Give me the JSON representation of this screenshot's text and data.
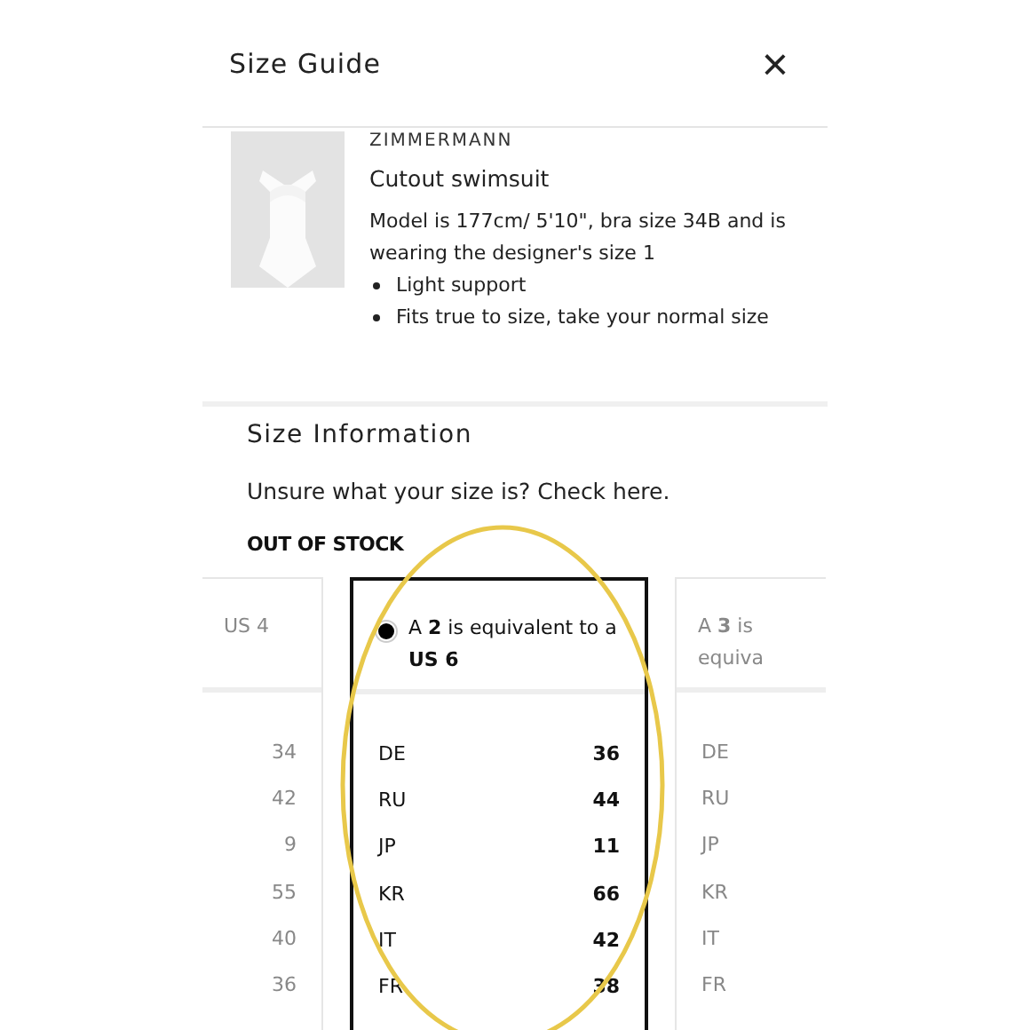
{
  "header": {
    "title": "Size Guide",
    "close": "×"
  },
  "product": {
    "brand": "ZIMMERMANN",
    "name": "Cutout swimsuit",
    "description": "Model is 177cm/ 5'10\", bra size 34B and is wearing the designer's size 1",
    "bullets": [
      "Light support",
      "Fits true to size, take your normal size"
    ]
  },
  "size_info": {
    "title": "Size Information",
    "help": "Unsure what your size is? Check here.",
    "stock": "OUT OF STOCK"
  },
  "cards": [
    {
      "kind": "values",
      "selected": false,
      "heading": "US 4",
      "rows": [
        {
          "value": "34"
        },
        {
          "value": "42"
        },
        {
          "value": "9"
        },
        {
          "value": "55"
        },
        {
          "value": "40"
        },
        {
          "value": "36"
        }
      ]
    },
    {
      "kind": "full",
      "selected": true,
      "heading": "A **2** is equivalent to a **US 6**",
      "rows": [
        {
          "label": "DE",
          "value": "36"
        },
        {
          "label": "RU",
          "value": "44"
        },
        {
          "label": "JP",
          "value": "11"
        },
        {
          "label": "KR",
          "value": "66"
        },
        {
          "label": "IT",
          "value": "42"
        },
        {
          "label": "FR",
          "value": "38"
        }
      ]
    },
    {
      "kind": "labels",
      "selected": false,
      "heading": "A **3** is equiva",
      "rows": [
        {
          "label": "DE"
        },
        {
          "label": "RU"
        },
        {
          "label": "JP"
        },
        {
          "label": "KR"
        },
        {
          "label": "IT"
        },
        {
          "label": "FR"
        }
      ]
    }
  ]
}
